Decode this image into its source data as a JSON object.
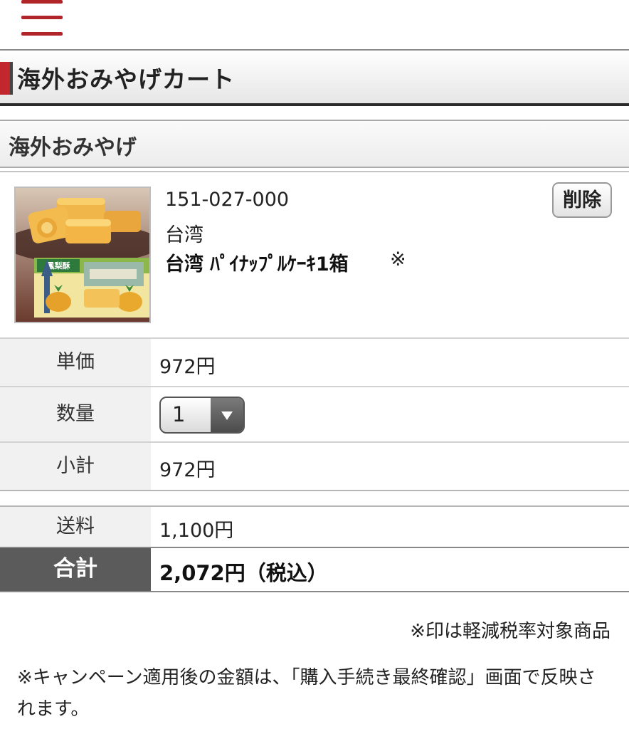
{
  "header": {
    "menu_icon": "hamburger-menu-icon",
    "menu_color": "#b0242a"
  },
  "page": {
    "title": "海外おみやげカート",
    "accent_color": "#c1272d"
  },
  "section": {
    "title": "海外おみやげ"
  },
  "item": {
    "code": "151-027-000",
    "region": "台湾",
    "name": "台湾 ﾊﾟｲﾅｯﾌﾟﾙｹｰｷ1箱",
    "reduced_tax_mark": "※",
    "delete_label": "削除",
    "image_text": "鳳梨酥"
  },
  "rows": {
    "unit_price": {
      "label": "単価",
      "value": "972円"
    },
    "quantity": {
      "label": "数量",
      "value": "1"
    },
    "subtotal": {
      "label": "小計",
      "value": "972円"
    },
    "shipping": {
      "label": "送料",
      "value": "1,100円"
    },
    "total": {
      "label": "合計",
      "value": "2,072円（税込）"
    }
  },
  "notes": {
    "reduced_tax": "※印は軽減税率対象商品",
    "campaign": "※キャンペーン適用後の金額は、「購入手続き最終確認」画面で反映されます。"
  }
}
